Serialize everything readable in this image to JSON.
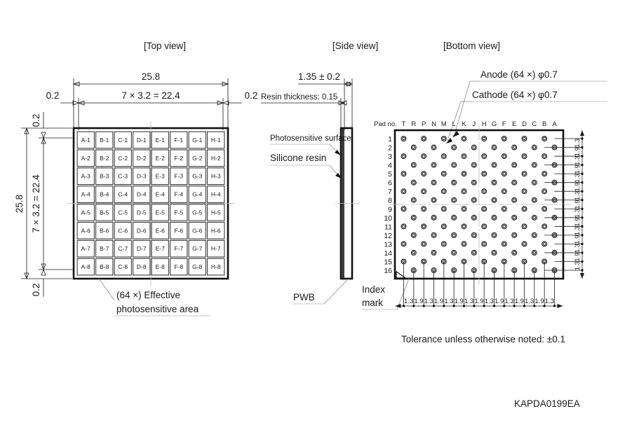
{
  "drawing": {
    "code": "KAPDA0199EA",
    "tolerance_note": "Tolerance unless otherwise noted: ±0.1"
  },
  "views": {
    "top": {
      "title": "[Top view]",
      "dims": {
        "overall_width": "25.8",
        "overall_height": "25.8",
        "pitch_row": "7 × 3.2 = 22.4",
        "pitch_col": "7 × 3.2 = 22.4",
        "margin_left": "0.2",
        "margin_right": "0.2",
        "margin_top": "0.2",
        "margin_bottom": "0.2"
      },
      "callout": {
        "line1": "(64 ×) Effective",
        "line2": "photosensitive area"
      },
      "grid": {
        "columns": [
          "A",
          "B",
          "C",
          "D",
          "E",
          "F",
          "G",
          "H"
        ],
        "rows": [
          "1",
          "2",
          "3",
          "4",
          "5",
          "6",
          "7",
          "8"
        ],
        "cells": [
          [
            "A-1",
            "B-1",
            "C-1",
            "D-1",
            "E-1",
            "F-1",
            "G-1",
            "H-1"
          ],
          [
            "A-2",
            "B-2",
            "C-2",
            "D-2",
            "E-2",
            "F-2",
            "G-2",
            "H-2"
          ],
          [
            "A-3",
            "B-3",
            "C-3",
            "D-3",
            "E-3",
            "F-3",
            "G-3",
            "H-3"
          ],
          [
            "A-4",
            "B-4",
            "C-4",
            "D-4",
            "E-4",
            "F-4",
            "G-4",
            "H-4"
          ],
          [
            "A-5",
            "B-5",
            "C-5",
            "D-5",
            "E-5",
            "F-5",
            "G-5",
            "H-5"
          ],
          [
            "A-6",
            "B-6",
            "C-6",
            "D-6",
            "E-6",
            "F-6",
            "G-6",
            "H-6"
          ],
          [
            "A-7",
            "B-7",
            "C-7",
            "D-7",
            "E-7",
            "F-7",
            "G-7",
            "H-7"
          ],
          [
            "A-8",
            "B-8",
            "C-8",
            "D-8",
            "E-8",
            "F-8",
            "G-8",
            "H-8"
          ]
        ]
      }
    },
    "side": {
      "title": "[Side view]",
      "dims": {
        "total_thickness": "1.35 ± 0.2",
        "resin_thickness": "Resin thickness: 0.15"
      },
      "labels": {
        "photosensitive_surface": "Photosensitive surface",
        "silicone_resin": "Silicone resin",
        "pwb": "PWB"
      }
    },
    "bottom": {
      "title": "[Bottom view]",
      "labels": {
        "anode": "Anode (64 ×) φ0.7",
        "cathode": "Cathode (64 ×) φ0.7",
        "pad_no": "Pad no.",
        "index_mark_line1": "Index",
        "index_mark_line2": "mark"
      },
      "pad_columns": [
        "T",
        "R",
        "P",
        "N",
        "M",
        "L",
        "K",
        "J",
        "H",
        "G",
        "F",
        "E",
        "D",
        "C",
        "B",
        "A"
      ],
      "pad_rows": [
        "1",
        "2",
        "3",
        "4",
        "5",
        "6",
        "7",
        "8",
        "9",
        "10",
        "11",
        "12",
        "13",
        "14",
        "15",
        "16"
      ],
      "dim_chain_bottom": [
        "1.3",
        "1.9",
        "1.3",
        "1.9",
        "1.3",
        "1.9",
        "1.3",
        "1.9",
        "1.3",
        "1.9",
        "1.3",
        "1.9",
        "1.3",
        "1.9",
        "1.3"
      ],
      "dim_chain_right": [
        "1.3",
        "1.9",
        "1.3",
        "1.9",
        "1.3",
        "1.9",
        "1.3",
        "1.9",
        "1.3",
        "1.9",
        "1.3",
        "1.9",
        "1.3",
        "1.9",
        "1.3"
      ]
    }
  }
}
